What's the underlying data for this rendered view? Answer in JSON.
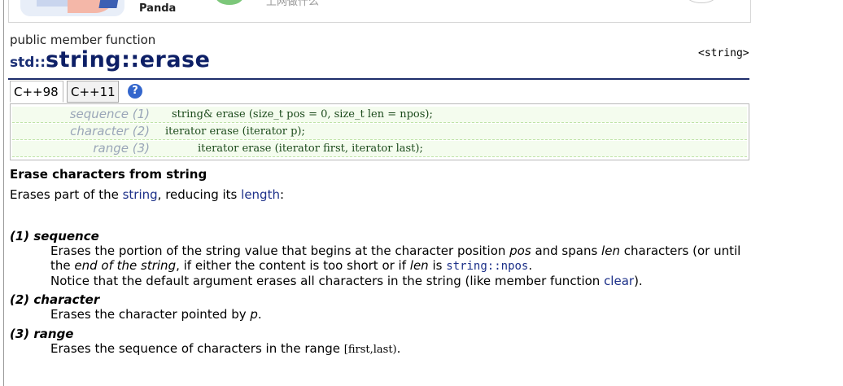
{
  "banner": {
    "brand": "Panda",
    "cn_text": "上网做什么"
  },
  "page": {
    "kind": "public member function",
    "ns": "std::",
    "name": "string::erase",
    "header": "<string>"
  },
  "tabs": [
    {
      "label": "C++98"
    },
    {
      "label": "C++11"
    }
  ],
  "help_glyph": "?",
  "prototypes": [
    {
      "label": "sequence (1)",
      "code": "string& erase (size_t pos = 0, size_t len = npos);"
    },
    {
      "label": "character (2)",
      "code": "iterator erase (iterator p);"
    },
    {
      "label": "range (3)",
      "code": "iterator erase (iterator first, iterator last);"
    }
  ],
  "summary": {
    "heading": "Erase characters from string",
    "t1": "Erases part of the ",
    "link1": "string",
    "t2": ", reducing its ",
    "link2": "length",
    "t3": ":"
  },
  "params": {
    "p1": {
      "title": "(1) sequence",
      "a": "Erases the portion of the string value that begins at the character position ",
      "b": "pos",
      "c": " and spans ",
      "d": "len",
      "e": " characters (or until",
      "f": "the ",
      "g": "end of the string",
      "h": ", if either the content is too short or if ",
      "i": "len",
      "j": " is ",
      "k": "string::npos",
      "l": ".",
      "m": "Notice that the default argument erases all characters in the string (like member function ",
      "n": "clear",
      "o": ")."
    },
    "p2": {
      "title": "(2) character",
      "a": "Erases the character pointed by ",
      "b": "p",
      "c": "."
    },
    "p3": {
      "title": "(3) range",
      "a": "Erases the sequence of characters in the range ",
      "b": "[first,last)",
      "c": "."
    }
  }
}
